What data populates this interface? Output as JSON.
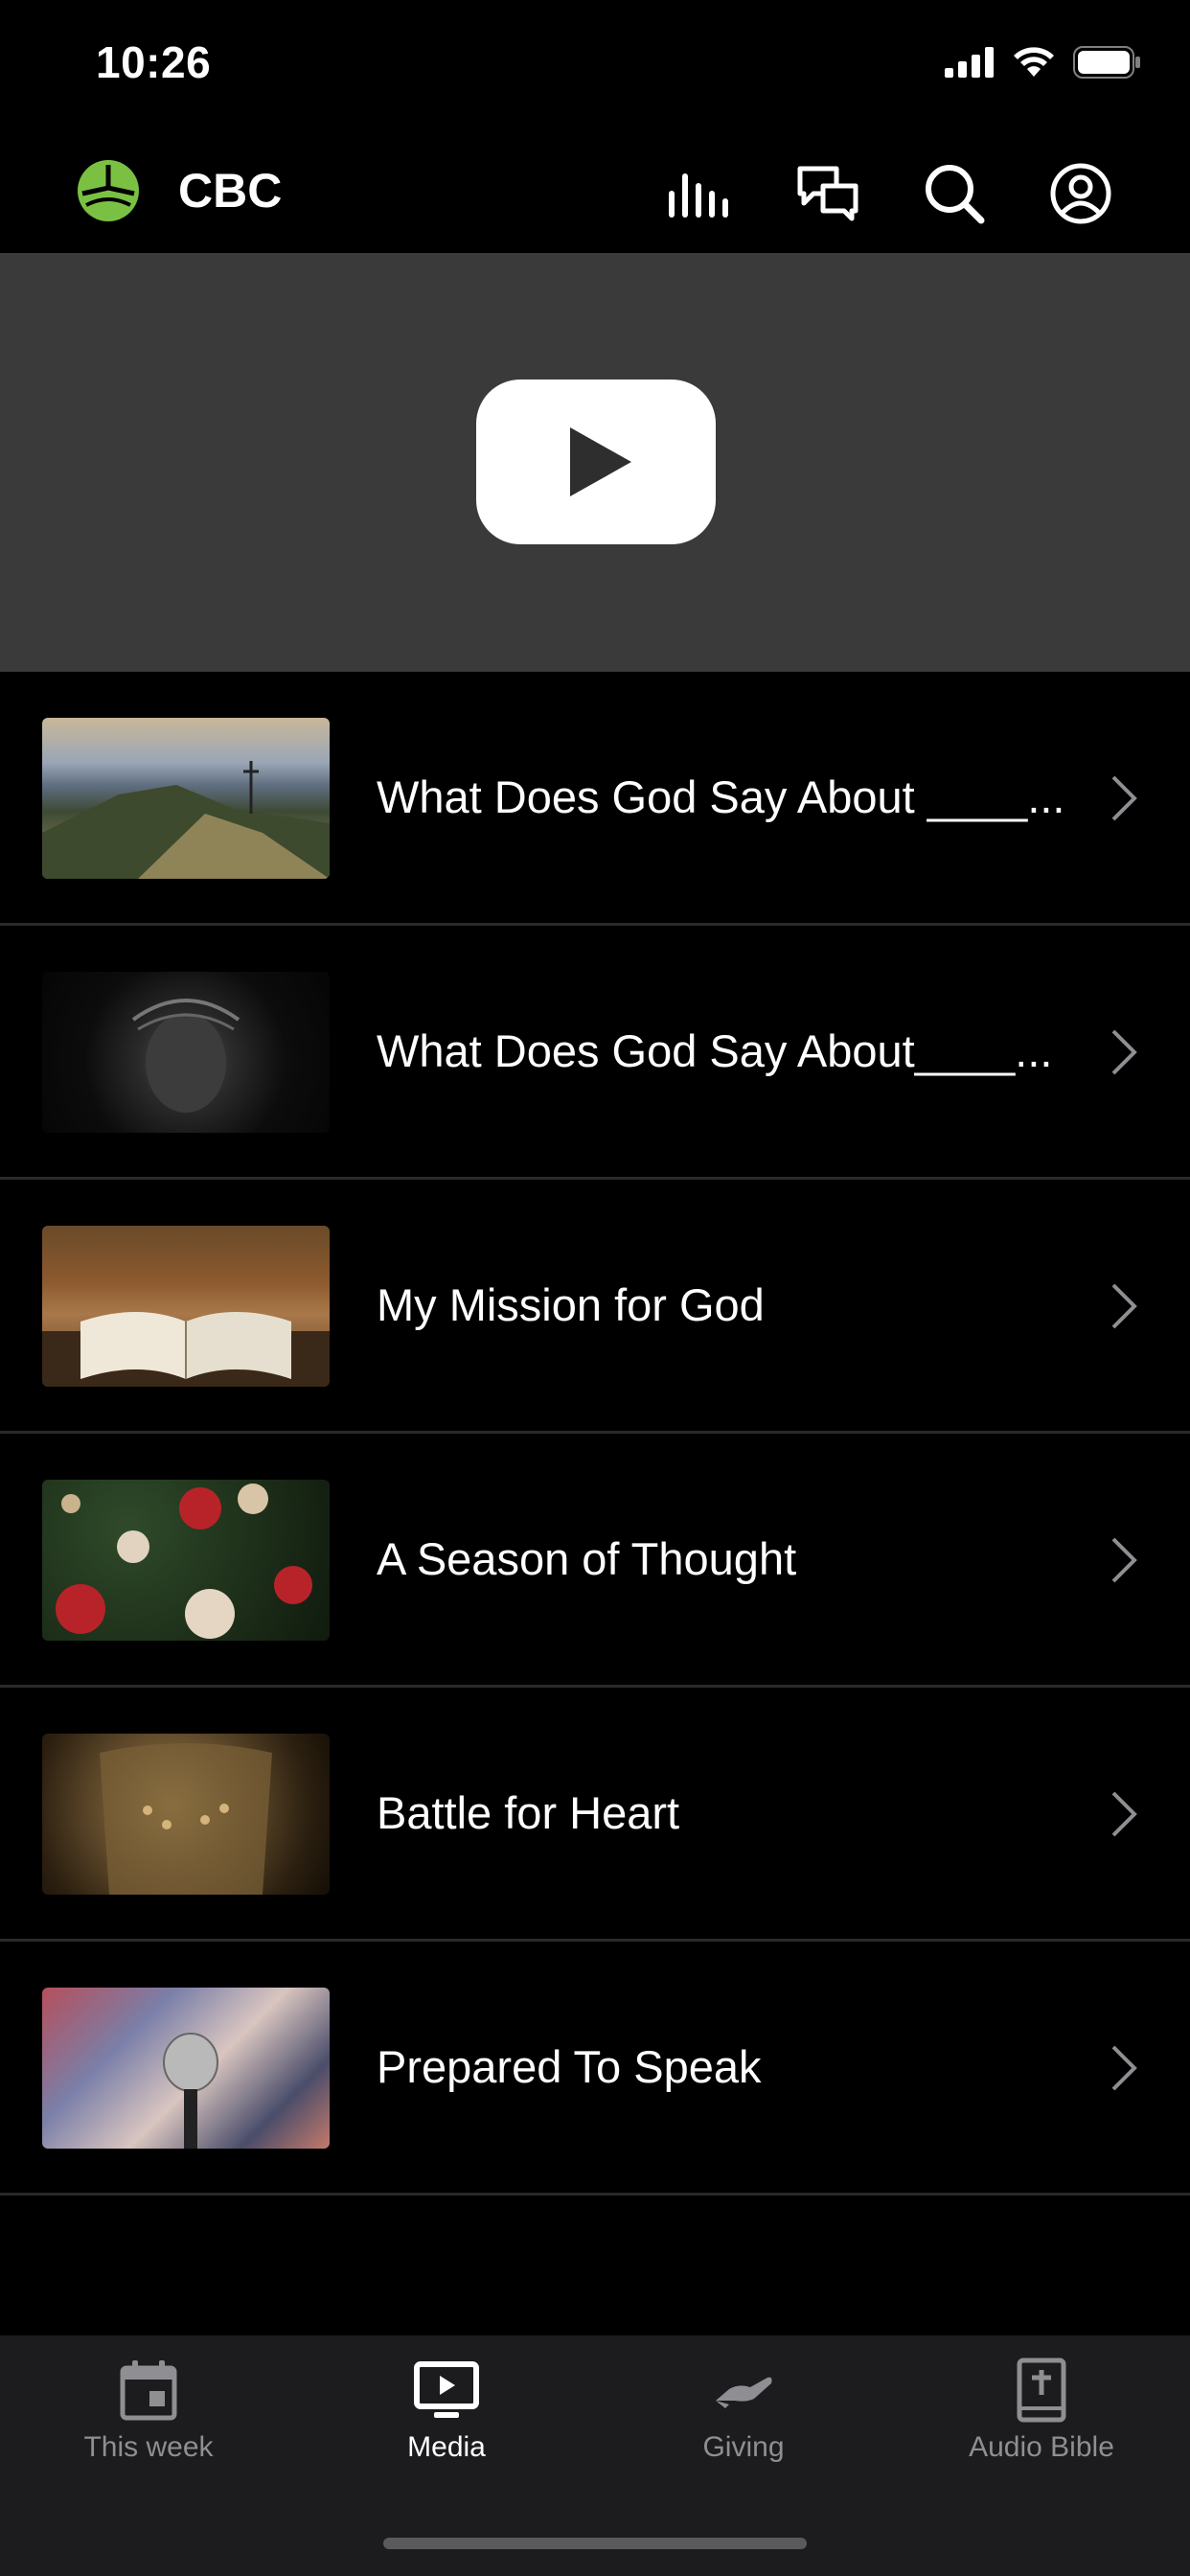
{
  "status_bar": {
    "time": "10:26"
  },
  "header": {
    "app_name": "CBC",
    "icons": [
      "bars-chart-icon",
      "chat-bubbles-icon",
      "search-icon",
      "profile-icon"
    ],
    "logo_color": "#7ac143"
  },
  "video_banner": {
    "icon": "youtube-play-icon"
  },
  "media": {
    "items": [
      {
        "title": "What Does God Say About ____...",
        "thumbnail": "mountain-cross"
      },
      {
        "title": "What Does God Say About____...",
        "thumbnail": "crown-of-thorns"
      },
      {
        "title": "My Mission for God",
        "thumbnail": "open-bible"
      },
      {
        "title": "A Season of Thought",
        "thumbnail": "christmas-ornaments"
      },
      {
        "title": "Battle for Heart",
        "thumbnail": "armor"
      },
      {
        "title": "Prepared To Speak",
        "thumbnail": "microphone-crowd"
      }
    ]
  },
  "tabs": [
    {
      "label": "This week",
      "icon": "calendar-icon",
      "active": false
    },
    {
      "label": "Media",
      "icon": "tv-play-icon",
      "active": true
    },
    {
      "label": "Giving",
      "icon": "giving-hand-icon",
      "active": false
    },
    {
      "label": "Audio Bible",
      "icon": "bible-icon",
      "active": false
    }
  ]
}
